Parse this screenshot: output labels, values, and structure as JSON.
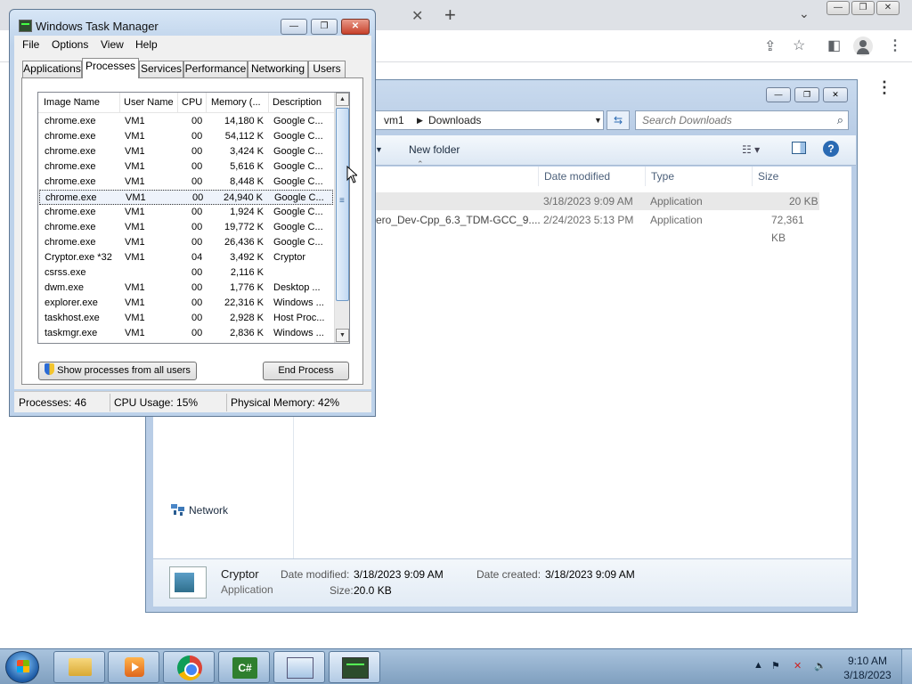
{
  "chrome": {
    "tab_close": "✕",
    "new_tab": "+",
    "tab_list_icon": "chevron-down-icon",
    "window_buttons": [
      "—",
      "❐",
      "✕"
    ],
    "toolbar_icons": [
      "share-icon",
      "star-icon",
      "sidebar-icon",
      "profile-icon",
      "menu-icon"
    ]
  },
  "explorer": {
    "window_buttons": [
      "—",
      "❐",
      "✕"
    ],
    "breadcrumb": [
      "vm1",
      "Downloads"
    ],
    "search_placeholder": "Search Downloads",
    "new_folder_label": "New folder",
    "columns": [
      "Date modified",
      "Type",
      "Size"
    ],
    "files": [
      {
        "name": "",
        "date": "3/18/2023 9:09 AM",
        "type": "Application",
        "size": "20 KB",
        "selected": true
      },
      {
        "name": "ero_Dev-Cpp_6.3_TDM-GCC_9....",
        "date": "2/24/2023 5:13 PM",
        "type": "Application",
        "size": "72,361 KB",
        "selected": false
      }
    ],
    "nav_network": "Network",
    "details": {
      "name": "Cryptor",
      "kind": "Application",
      "date_modified_label": "Date modified:",
      "date_modified": "3/18/2023 9:09 AM",
      "size_label": "Size:",
      "size": "20.0 KB",
      "date_created_label": "Date created:",
      "date_created": "3/18/2023 9:09 AM"
    }
  },
  "taskmgr": {
    "title": "Windows Task Manager",
    "menu": [
      "File",
      "Options",
      "View",
      "Help"
    ],
    "tabs": [
      "Applications",
      "Processes",
      "Services",
      "Performance",
      "Networking",
      "Users"
    ],
    "active_tab": "Processes",
    "columns": [
      "Image Name",
      "User Name",
      "CPU",
      "Memory (...",
      "Description"
    ],
    "processes": [
      {
        "image": "chrome.exe",
        "user": "VM1",
        "cpu": "00",
        "mem": "14,180 K",
        "desc": "Google C..."
      },
      {
        "image": "chrome.exe",
        "user": "VM1",
        "cpu": "00",
        "mem": "54,112 K",
        "desc": "Google C..."
      },
      {
        "image": "chrome.exe",
        "user": "VM1",
        "cpu": "00",
        "mem": "3,424 K",
        "desc": "Google C..."
      },
      {
        "image": "chrome.exe",
        "user": "VM1",
        "cpu": "00",
        "mem": "5,616 K",
        "desc": "Google C..."
      },
      {
        "image": "chrome.exe",
        "user": "VM1",
        "cpu": "00",
        "mem": "8,448 K",
        "desc": "Google C..."
      },
      {
        "image": "chrome.exe",
        "user": "VM1",
        "cpu": "00",
        "mem": "24,940 K",
        "desc": "Google C...",
        "selected": true
      },
      {
        "image": "chrome.exe",
        "user": "VM1",
        "cpu": "00",
        "mem": "1,924 K",
        "desc": "Google C..."
      },
      {
        "image": "chrome.exe",
        "user": "VM1",
        "cpu": "00",
        "mem": "19,772 K",
        "desc": "Google C..."
      },
      {
        "image": "chrome.exe",
        "user": "VM1",
        "cpu": "00",
        "mem": "26,436 K",
        "desc": "Google C..."
      },
      {
        "image": "Cryptor.exe *32",
        "user": "VM1",
        "cpu": "04",
        "mem": "3,492 K",
        "desc": "Cryptor"
      },
      {
        "image": "csrss.exe",
        "user": "",
        "cpu": "00",
        "mem": "2,116 K",
        "desc": ""
      },
      {
        "image": "dwm.exe",
        "user": "VM1",
        "cpu": "00",
        "mem": "1,776 K",
        "desc": "Desktop ..."
      },
      {
        "image": "explorer.exe",
        "user": "VM1",
        "cpu": "00",
        "mem": "22,316 K",
        "desc": "Windows ..."
      },
      {
        "image": "taskhost.exe",
        "user": "VM1",
        "cpu": "00",
        "mem": "2,928 K",
        "desc": "Host Proc..."
      },
      {
        "image": "taskmgr.exe",
        "user": "VM1",
        "cpu": "00",
        "mem": "2,836 K",
        "desc": "Windows ..."
      }
    ],
    "show_all_button": "Show processes from all users",
    "end_process_button": "End Process",
    "status": {
      "processes": "Processes: 46",
      "cpu": "CPU Usage: 15%",
      "memory": "Physical Memory: 42%"
    }
  },
  "taskbar": {
    "pinned": [
      "explorer-icon",
      "media-player-icon",
      "chrome-icon",
      "csharp-icon",
      "control-panel-icon",
      "task-manager-icon"
    ],
    "clock_time": "9:10 AM",
    "clock_date": "3/18/2023"
  }
}
